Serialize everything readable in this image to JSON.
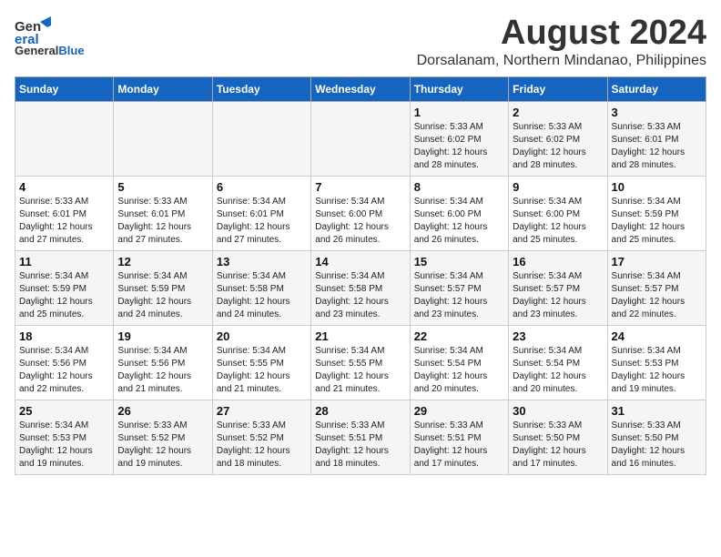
{
  "header": {
    "logo_line1": "General",
    "logo_line2": "Blue",
    "month_title": "August 2024",
    "location": "Dorsalanam, Northern Mindanao, Philippines"
  },
  "weekdays": [
    "Sunday",
    "Monday",
    "Tuesday",
    "Wednesday",
    "Thursday",
    "Friday",
    "Saturday"
  ],
  "weeks": [
    [
      {
        "day": "",
        "info": ""
      },
      {
        "day": "",
        "info": ""
      },
      {
        "day": "",
        "info": ""
      },
      {
        "day": "",
        "info": ""
      },
      {
        "day": "1",
        "info": "Sunrise: 5:33 AM\nSunset: 6:02 PM\nDaylight: 12 hours\nand 28 minutes."
      },
      {
        "day": "2",
        "info": "Sunrise: 5:33 AM\nSunset: 6:02 PM\nDaylight: 12 hours\nand 28 minutes."
      },
      {
        "day": "3",
        "info": "Sunrise: 5:33 AM\nSunset: 6:01 PM\nDaylight: 12 hours\nand 28 minutes."
      }
    ],
    [
      {
        "day": "4",
        "info": "Sunrise: 5:33 AM\nSunset: 6:01 PM\nDaylight: 12 hours\nand 27 minutes."
      },
      {
        "day": "5",
        "info": "Sunrise: 5:33 AM\nSunset: 6:01 PM\nDaylight: 12 hours\nand 27 minutes."
      },
      {
        "day": "6",
        "info": "Sunrise: 5:34 AM\nSunset: 6:01 PM\nDaylight: 12 hours\nand 27 minutes."
      },
      {
        "day": "7",
        "info": "Sunrise: 5:34 AM\nSunset: 6:00 PM\nDaylight: 12 hours\nand 26 minutes."
      },
      {
        "day": "8",
        "info": "Sunrise: 5:34 AM\nSunset: 6:00 PM\nDaylight: 12 hours\nand 26 minutes."
      },
      {
        "day": "9",
        "info": "Sunrise: 5:34 AM\nSunset: 6:00 PM\nDaylight: 12 hours\nand 25 minutes."
      },
      {
        "day": "10",
        "info": "Sunrise: 5:34 AM\nSunset: 5:59 PM\nDaylight: 12 hours\nand 25 minutes."
      }
    ],
    [
      {
        "day": "11",
        "info": "Sunrise: 5:34 AM\nSunset: 5:59 PM\nDaylight: 12 hours\nand 25 minutes."
      },
      {
        "day": "12",
        "info": "Sunrise: 5:34 AM\nSunset: 5:59 PM\nDaylight: 12 hours\nand 24 minutes."
      },
      {
        "day": "13",
        "info": "Sunrise: 5:34 AM\nSunset: 5:58 PM\nDaylight: 12 hours\nand 24 minutes."
      },
      {
        "day": "14",
        "info": "Sunrise: 5:34 AM\nSunset: 5:58 PM\nDaylight: 12 hours\nand 23 minutes."
      },
      {
        "day": "15",
        "info": "Sunrise: 5:34 AM\nSunset: 5:57 PM\nDaylight: 12 hours\nand 23 minutes."
      },
      {
        "day": "16",
        "info": "Sunrise: 5:34 AM\nSunset: 5:57 PM\nDaylight: 12 hours\nand 23 minutes."
      },
      {
        "day": "17",
        "info": "Sunrise: 5:34 AM\nSunset: 5:57 PM\nDaylight: 12 hours\nand 22 minutes."
      }
    ],
    [
      {
        "day": "18",
        "info": "Sunrise: 5:34 AM\nSunset: 5:56 PM\nDaylight: 12 hours\nand 22 minutes."
      },
      {
        "day": "19",
        "info": "Sunrise: 5:34 AM\nSunset: 5:56 PM\nDaylight: 12 hours\nand 21 minutes."
      },
      {
        "day": "20",
        "info": "Sunrise: 5:34 AM\nSunset: 5:55 PM\nDaylight: 12 hours\nand 21 minutes."
      },
      {
        "day": "21",
        "info": "Sunrise: 5:34 AM\nSunset: 5:55 PM\nDaylight: 12 hours\nand 21 minutes."
      },
      {
        "day": "22",
        "info": "Sunrise: 5:34 AM\nSunset: 5:54 PM\nDaylight: 12 hours\nand 20 minutes."
      },
      {
        "day": "23",
        "info": "Sunrise: 5:34 AM\nSunset: 5:54 PM\nDaylight: 12 hours\nand 20 minutes."
      },
      {
        "day": "24",
        "info": "Sunrise: 5:34 AM\nSunset: 5:53 PM\nDaylight: 12 hours\nand 19 minutes."
      }
    ],
    [
      {
        "day": "25",
        "info": "Sunrise: 5:34 AM\nSunset: 5:53 PM\nDaylight: 12 hours\nand 19 minutes."
      },
      {
        "day": "26",
        "info": "Sunrise: 5:33 AM\nSunset: 5:52 PM\nDaylight: 12 hours\nand 19 minutes."
      },
      {
        "day": "27",
        "info": "Sunrise: 5:33 AM\nSunset: 5:52 PM\nDaylight: 12 hours\nand 18 minutes."
      },
      {
        "day": "28",
        "info": "Sunrise: 5:33 AM\nSunset: 5:51 PM\nDaylight: 12 hours\nand 18 minutes."
      },
      {
        "day": "29",
        "info": "Sunrise: 5:33 AM\nSunset: 5:51 PM\nDaylight: 12 hours\nand 17 minutes."
      },
      {
        "day": "30",
        "info": "Sunrise: 5:33 AM\nSunset: 5:50 PM\nDaylight: 12 hours\nand 17 minutes."
      },
      {
        "day": "31",
        "info": "Sunrise: 5:33 AM\nSunset: 5:50 PM\nDaylight: 12 hours\nand 16 minutes."
      }
    ]
  ]
}
